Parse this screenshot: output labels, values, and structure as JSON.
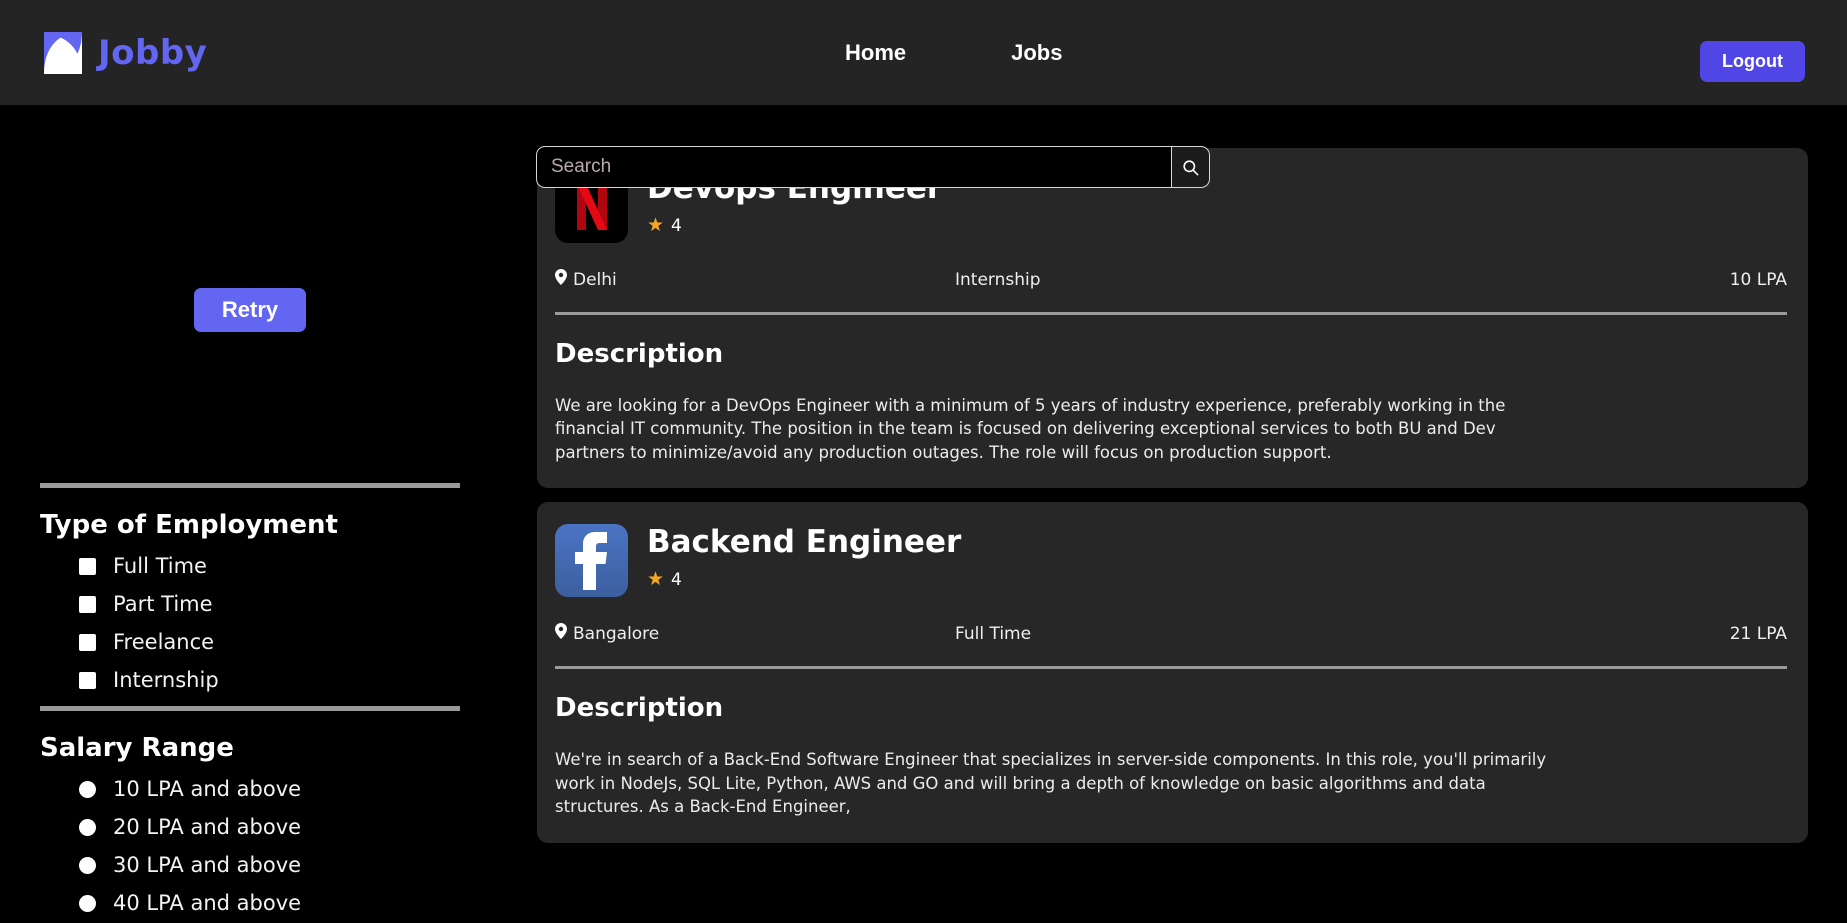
{
  "navbar": {
    "brand": "Jobby",
    "logo_icon": "jobby-logo-icon",
    "links": [
      {
        "label": "Home",
        "name": "nav-link-home"
      },
      {
        "label": "Jobs",
        "name": "nav-link-jobs"
      }
    ],
    "logout_label": "Logout",
    "brand_color": "#6366f1",
    "logout_color": "#4f46e5",
    "background": "#242424"
  },
  "search": {
    "value": "",
    "placeholder": "Search",
    "button_icon": "search-icon"
  },
  "sidebar": {
    "retry_label": "Retry",
    "retry_color": "#6366f1",
    "employment": {
      "title": "Type of Employment",
      "options": [
        {
          "label": "Full Time",
          "checked": false
        },
        {
          "label": "Part Time",
          "checked": false
        },
        {
          "label": "Freelance",
          "checked": false
        },
        {
          "label": "Internship",
          "checked": false
        }
      ]
    },
    "salary": {
      "title": "Salary Range",
      "options": [
        {
          "label": "10 LPA and above",
          "selected": false
        },
        {
          "label": "20 LPA and above",
          "selected": false
        },
        {
          "label": "30 LPA and above",
          "selected": false
        },
        {
          "label": "40 LPA and above",
          "selected": false
        }
      ]
    }
  },
  "jobs": [
    {
      "company_logo": "netflix-logo-icon",
      "title": "Devops Engineer",
      "rating": "4",
      "star_icon": "star-icon",
      "location": "Delhi",
      "location_icon": "location-pin-icon",
      "employment_type": "Internship",
      "package": "10 LPA",
      "description_heading": "Description",
      "description": "We are looking for a DevOps Engineer with a minimum of 5 years of industry experience, preferably working in the financial IT community. The position in the team is focused on delivering exceptional services to both BU and Dev partners to minimize/avoid any production outages. The role will focus on production support."
    },
    {
      "company_logo": "facebook-logo-icon",
      "title": "Backend Engineer",
      "rating": "4",
      "star_icon": "star-icon",
      "location": "Bangalore",
      "location_icon": "location-pin-icon",
      "employment_type": "Full Time",
      "package": "21 LPA",
      "description_heading": "Description",
      "description": "We're in search of a Back-End Software Engineer that specializes in server-side components. In this role, you'll primarily work in NodeJs, SQL Lite, Python, AWS and GO and will bring a depth of knowledge on basic algorithms and data structures. As a Back-End Engineer,"
    }
  ]
}
